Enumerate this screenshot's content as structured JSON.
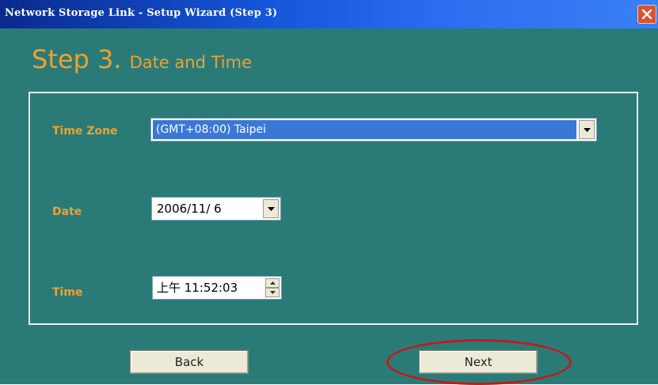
{
  "window": {
    "title": "Network Storage Link - Setup Wizard (Step 3)",
    "close_icon": "close-icon",
    "background_color": "#2a7b78",
    "accent_color": "#f0a030"
  },
  "header": {
    "step": "Step 3.",
    "subtitle": "Date and Time"
  },
  "form": {
    "time_zone": {
      "label": "Time Zone",
      "value": "(GMT+08:00) Taipei"
    },
    "date": {
      "label": "Date",
      "value": "2006/11/ 6"
    },
    "time": {
      "label": "Time",
      "value": "上午 11:52:03"
    }
  },
  "footer": {
    "back_label": "Back",
    "next_label": "Next",
    "highlight_color": "#c11a1a"
  }
}
